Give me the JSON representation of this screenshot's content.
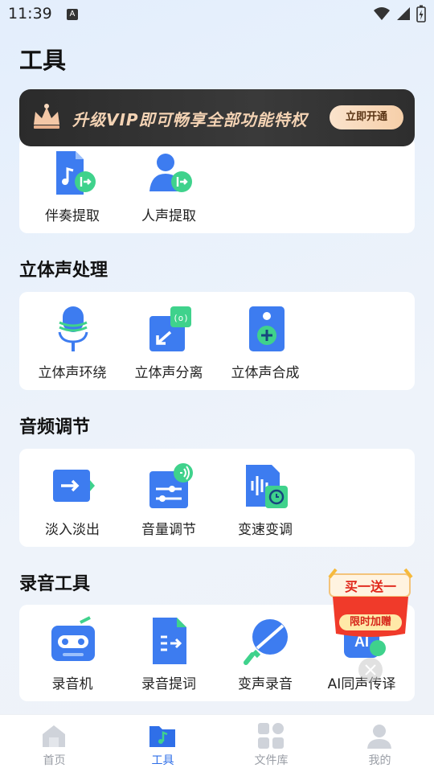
{
  "status_bar": {
    "time": "11:39",
    "notification_letter": "A"
  },
  "page": {
    "title": "工具"
  },
  "vip_banner": {
    "text": "升级VIP即可畅享全部功能特权",
    "button_label": "立即开通"
  },
  "sections": [
    {
      "title": "",
      "tools": [
        {
          "label": "伴奏提取",
          "icon": "music-file-export-icon"
        },
        {
          "label": "人声提取",
          "icon": "person-export-icon"
        }
      ]
    },
    {
      "title": "立体声处理",
      "tools": [
        {
          "label": "立体声环绕",
          "icon": "microphone-wave-icon"
        },
        {
          "label": "立体声分离",
          "icon": "split-arrow-icon"
        },
        {
          "label": "立体声合成",
          "icon": "speaker-plus-icon"
        }
      ]
    },
    {
      "title": "音频调节",
      "tools": [
        {
          "label": "淡入淡出",
          "icon": "fade-arrow-icon"
        },
        {
          "label": "音量调节",
          "icon": "volume-slider-icon"
        },
        {
          "label": "变速变调",
          "icon": "waveform-clock-icon"
        }
      ]
    },
    {
      "title": "录音工具",
      "tools": [
        {
          "label": "录音机",
          "icon": "cassette-icon"
        },
        {
          "label": "录音提词",
          "icon": "teleprompter-icon"
        },
        {
          "label": "变声录音",
          "icon": "voice-change-mic-icon"
        },
        {
          "label": "AI同声传译",
          "icon": "ai-translate-icon"
        }
      ]
    }
  ],
  "promo": {
    "top_text": "买一送一",
    "bottom_text": "限时加赠"
  },
  "bottom_nav": [
    {
      "label": "首页",
      "icon": "home-icon",
      "active": false
    },
    {
      "label": "工具",
      "icon": "tools-folder-icon",
      "active": true
    },
    {
      "label": "文件库",
      "icon": "grid-icon",
      "active": false
    },
    {
      "label": "我的",
      "icon": "profile-icon",
      "active": false
    }
  ],
  "colors": {
    "accent": "#2f6fe8",
    "icon_blue": "#3d7cf0",
    "icon_green": "#3fd28c",
    "vip_gold": "#f4d3b4",
    "promo_red": "#f03a2a"
  }
}
